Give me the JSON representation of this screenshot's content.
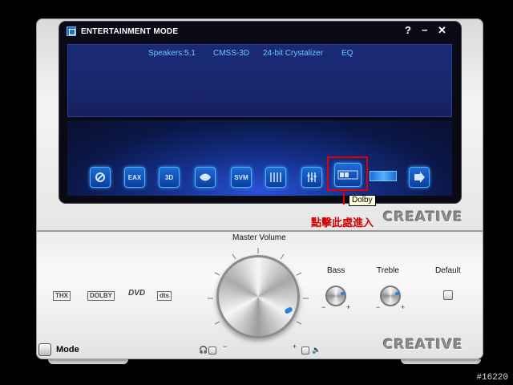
{
  "window": {
    "title": "ENTERTAINMENT MODE",
    "help_label": "?",
    "minimize_label": "−",
    "close_label": "✕"
  },
  "status_bar": {
    "speakers": "Speakers:5.1",
    "cmss": "CMSS-3D",
    "crystalizer": "24-bit Crystalizer",
    "eq": "EQ"
  },
  "effects": [
    {
      "icon": "speaker-icon",
      "label": ""
    },
    {
      "icon": "eax-icon",
      "label": "EAX"
    },
    {
      "icon": "3d-icon",
      "label": "3D"
    },
    {
      "icon": "crystalizer-icon",
      "label": ""
    },
    {
      "icon": "svm-icon",
      "label": "SVM"
    },
    {
      "icon": "eq-icon",
      "label": ""
    },
    {
      "icon": "mixer-icon",
      "label": ""
    },
    {
      "icon": "dolby-icon",
      "label": ""
    },
    {
      "icon": "dts-icon",
      "label": ""
    },
    {
      "icon": "next-icon",
      "label": ""
    }
  ],
  "tooltip": "Dolby",
  "annotation": "點擊此處進入",
  "brand": "CREATIVE",
  "controls": {
    "master_volume_label": "Master Volume",
    "bass_label": "Bass",
    "treble_label": "Treble",
    "default_label": "Default",
    "minus": "−",
    "plus": "+",
    "mode_label": "Mode"
  },
  "logos": {
    "thx": "THX",
    "dolby": "DOLBY",
    "dvd": "DVD",
    "dts": "dts"
  },
  "serial": "#16220",
  "colors": {
    "accent_blue": "#2a7fe0",
    "status_text": "#6ec6ff",
    "highlight_red": "#e00000"
  }
}
